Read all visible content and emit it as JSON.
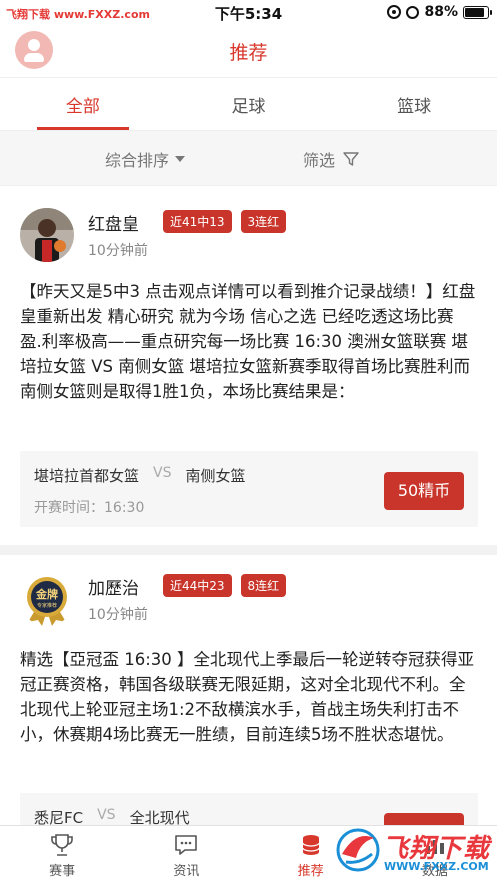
{
  "status_bar": {
    "source_text": "飞翔下载 www.FXXZ.com",
    "time": "下午5:34",
    "battery": "88%",
    "battery_level": 0.88
  },
  "header": {
    "title": "推荐"
  },
  "tabs": [
    {
      "label": "全部",
      "active": true
    },
    {
      "label": "足球",
      "active": false
    },
    {
      "label": "篮球",
      "active": false
    }
  ],
  "filter_bar": {
    "sort_label": "综合排序",
    "filter_label": "筛选"
  },
  "posts": [
    {
      "author": "红盘皇",
      "badges": [
        "近41中13",
        "3连红"
      ],
      "time": "10分钟前",
      "text": "【昨天又是5中3  点击观点详情可以看到推介记录战绩！】红盘皇重新出发 精心研究 就为今场 信心之选 已经吃透这场比赛 盈.利率极高——重点研究每一场比赛 16:30 澳洲女篮联赛  堪培拉女篮  VS  南侧女篮  堪培拉女篮新赛季取得首场比赛胜利而南侧女篮则是取得1胜1负，本场比赛结果是：",
      "home": "堪培拉首都女篮",
      "vs": "VS",
      "away": "南侧女篮",
      "match_time": "开赛时间：16:30",
      "price": "50精币"
    },
    {
      "author": "加歷治",
      "badges": [
        "近44中23",
        "8连红"
      ],
      "time": "10分钟前",
      "avatar_text": "金牌",
      "avatar_subtext": "专家推荐",
      "text": "精选【亞冠盃 16:30 】全北现代上季最后一轮逆转夺冠获得亚冠正赛资格，韩国各级联赛无限延期，这对全北现代不利。全北现代上轮亚冠主场1:2不敌横滨水手，首战主场失利打击不小，休赛期4场比赛无一胜绩，目前连续5场不胜状态堪忧。",
      "home": "悉尼FC",
      "vs": "VS",
      "away": "全北现代"
    }
  ],
  "bottom_nav": [
    {
      "label": "赛事",
      "icon": "trophy-icon",
      "active": false
    },
    {
      "label": "资讯",
      "icon": "chat-icon",
      "active": false
    },
    {
      "label": "推荐",
      "icon": "coins-icon",
      "active": true
    },
    {
      "label": "数据",
      "icon": "chart-icon",
      "active": false
    }
  ],
  "watermark": {
    "text": "飞翔下载",
    "url": "WWW.FXXZ.COM"
  },
  "colors": {
    "brand_red": "#d8382c",
    "badge_red": "#c9352b"
  }
}
